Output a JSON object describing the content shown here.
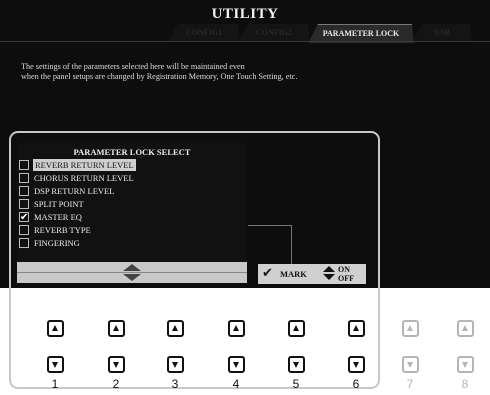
{
  "screen": {
    "title": "UTILITY",
    "tabs": [
      "CONFIG1",
      "CONFIG2",
      "PARAMETER LOCK",
      "USB"
    ],
    "active_tab": "PARAMETER LOCK",
    "description": [
      "The settings of the parameters selected here will be maintained even",
      "when the panel setups are changed by Registration Memory, One Touch Setting, etc."
    ]
  },
  "lock_select": {
    "title": "PARAMETER LOCK SELECT",
    "items": [
      {
        "label": "REVERB RETURN LEVEL",
        "checked": false,
        "highlighted": true
      },
      {
        "label": "CHORUS RETURN LEVEL",
        "checked": false,
        "highlighted": false
      },
      {
        "label": "DSP RETURN LEVEL",
        "checked": false,
        "highlighted": false
      },
      {
        "label": "SPLIT POINT",
        "checked": false,
        "highlighted": false
      },
      {
        "label": "MASTER EQ",
        "checked": true,
        "highlighted": false
      },
      {
        "label": "REVERB TYPE",
        "checked": false,
        "highlighted": false
      },
      {
        "label": "FINGERING",
        "checked": false,
        "highlighted": false
      }
    ]
  },
  "mark_bar": {
    "mark_label": "MARK",
    "on_label": "ON",
    "off_label": "OFF"
  },
  "buttons": {
    "numbers": [
      "1",
      "2",
      "3",
      "4",
      "5",
      "6",
      "7",
      "8"
    ],
    "active_count": 6
  },
  "colors": {
    "screen_bg": "#0d0d0d",
    "highlight": "#cfcfcf",
    "frame": "#c8c8c8",
    "inactive_button": "#b5b5b5"
  }
}
